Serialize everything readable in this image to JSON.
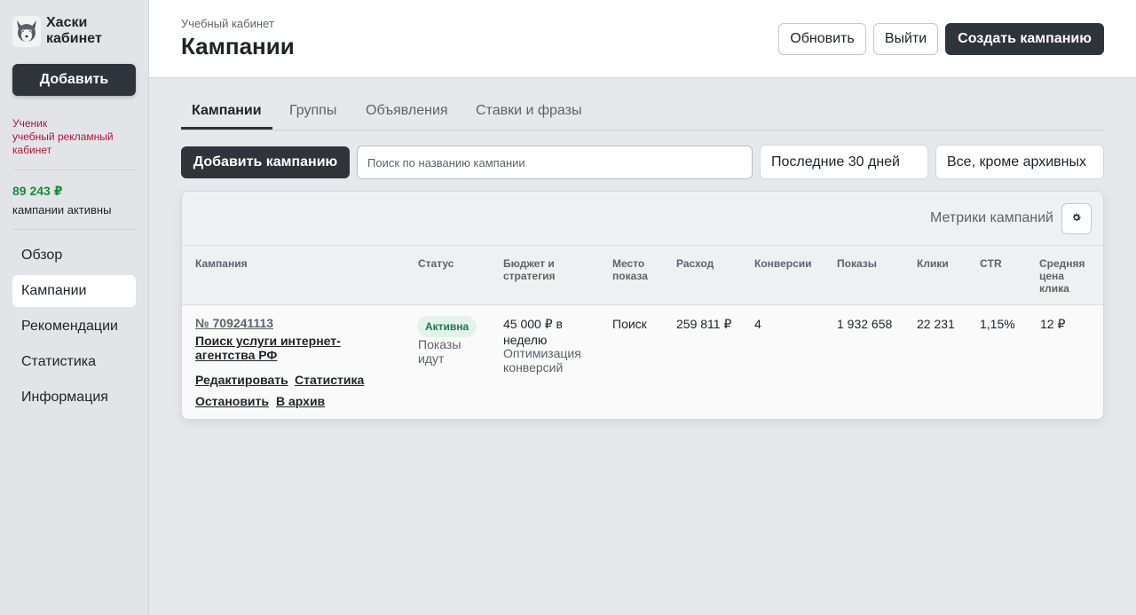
{
  "sidebar": {
    "brand": "Хаски кабинет",
    "add_button": "Добавить",
    "user_lines": [
      "Ученик",
      "учебный рекламный кабинет"
    ],
    "balance": "89 243 ₽",
    "balance_sub": "кампании активны",
    "nav": [
      "Обзор",
      "Кампании",
      "Рекомендации",
      "Статистика",
      "Информация"
    ],
    "active_nav": "Кампании"
  },
  "header": {
    "breadcrumb": "Учебный кабинет",
    "title": "Кампании",
    "refresh": "Обновить",
    "logout": "Выйти",
    "create": "Создать кампанию"
  },
  "tabs": [
    "Кампании",
    "Группы",
    "Объявления",
    "Ставки и фразы"
  ],
  "toolbar": {
    "add": "Добавить кампанию",
    "search_placeholder": "Поиск по названию кампании",
    "period": "Последние 30 дней",
    "filter": "Все, кроме архивных"
  },
  "card": {
    "metrics_label": "Метрики кампаний",
    "gear_icon": "gear-icon"
  },
  "table": {
    "headers": {
      "campaign": "Кампания",
      "status": "Статус",
      "budget": "Бюджет и стратегия",
      "placement": "Место показа",
      "spend": "Расход",
      "conversions": "Конверсии",
      "impressions": "Показы",
      "clicks": "Клики",
      "ctr": "CTR",
      "cpc": "Средняя цена клика"
    },
    "rows": [
      {
        "id": "№ 709241113",
        "name": "Поиск услуги интернет-агентства РФ",
        "actions": [
          "Редактировать",
          "Статистика",
          "Остановить",
          "В архив"
        ],
        "status_badge": "Активна",
        "status_sub": "Показы идут",
        "budget": "45 000 ₽ в неделю",
        "strategy": "Оптимизация конверсий",
        "placement": "Поиск",
        "spend": "259 811 ₽",
        "conversions": "4",
        "impressions": "1 932 658",
        "clicks": "22 231",
        "ctr": "1,15%",
        "cpc": "12 ₽"
      }
    ]
  },
  "colors": {
    "primary_dark": "#2f343b",
    "balance_green": "#1b8a3a",
    "user_red": "#b3133a",
    "badge_green": "#1b7a45"
  }
}
